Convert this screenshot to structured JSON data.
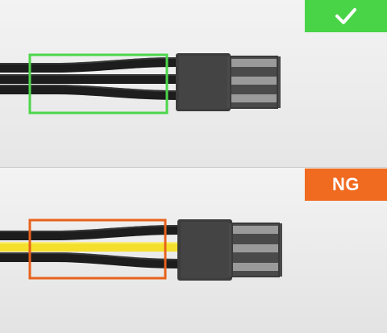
{
  "good_example": {
    "badge_icon": "check-icon",
    "badge_color": "#49d447",
    "highlight_color": "#4cd64a",
    "wire_colors": [
      "#1f1f1f",
      "#1f1f1f",
      "#1f1f1f"
    ]
  },
  "bad_example": {
    "badge_text": "NG",
    "badge_color": "#f06a1f",
    "highlight_color": "#e8621b",
    "wire_colors": [
      "#1f1f1f",
      "#f4e02c",
      "#1f1f1f"
    ]
  }
}
